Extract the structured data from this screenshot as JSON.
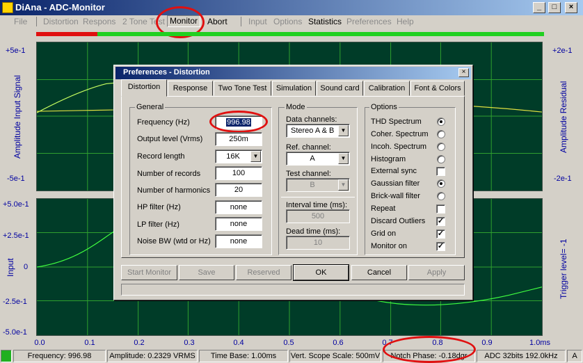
{
  "window": {
    "title": "DiAna - ADC-Monitor",
    "minimize": "_",
    "maximize": "□",
    "close": "×"
  },
  "menu": {
    "file": "File",
    "distortion": "Distortion",
    "respons": "Respons",
    "two_tone": "2 Tone Test",
    "monitor": "Monitor",
    "abort": "Abort",
    "input": "Input",
    "options": "Options",
    "statistics": "Statistics",
    "preferences": "Preferences",
    "help": "Help"
  },
  "level": {
    "left_fraction": 0.07,
    "colors": {
      "left": "#e01010",
      "right": "#20d020"
    }
  },
  "top_plot": {
    "y_left_top": "+5e-1",
    "y_left_bottom": "-5e-1",
    "y_right_top": "+2e-1",
    "y_right_bottom": "-2e-1",
    "left_label": "Amplitude Input Signal",
    "right_label": "Amplitude Residual"
  },
  "bottom_plot": {
    "y_ticks": [
      "+5.0e-1",
      "+2.5e-1",
      "0",
      "-2.5e-1",
      "-5.0e-1"
    ],
    "left_label": "Input",
    "right_label": "Trigger level= -1"
  },
  "x_ticks": [
    "0.0",
    "0.1",
    "0.2",
    "0.3",
    "0.4",
    "0.5",
    "0.6",
    "0.7",
    "0.8",
    "0.9",
    "1.0ms"
  ],
  "status": {
    "frequency": "Frequency: 996.98",
    "amplitude": "Amplitude: 0.2329 VRMS",
    "timebase": "Time Base: 1.00ms",
    "scope_scale": "Vert. Scope Scale: 500mV",
    "notch": "Notch Phase:  -0.18dgr",
    "adc": "ADC 32bits 192.0kHz",
    "mode": "A"
  },
  "dialog": {
    "title": "Preferences - Distortion",
    "close": "×",
    "tabs": [
      "Distortion",
      "Response",
      "Two Tone Test",
      "Simulation",
      "Sound card",
      "Calibration",
      "Font & Colors"
    ],
    "general": {
      "title": "General",
      "frequency_label": "Frequency (Hz)",
      "frequency": "996.98",
      "output_label": "Output level (Vrms)",
      "output": "250m",
      "record_length_label": "Record length",
      "record_length": "16K",
      "records_label": "Number of records",
      "records": "100",
      "harmonics_label": "Number of harmonics",
      "harmonics": "20",
      "hp_label": "HP filter (Hz)",
      "hp": "none",
      "lp_label": "LP filter (Hz)",
      "lp": "none",
      "noise_label": "Noise BW (wtd or Hz)",
      "noise": "none"
    },
    "mode": {
      "title": "Mode",
      "data_channels_label": "Data channels:",
      "data_channels": "Stereo A & B",
      "ref_label": "Ref. channel:",
      "ref": "A",
      "test_label": "Test channel:",
      "test": "B",
      "interval_label": "Interval time (ms):",
      "interval": "500",
      "dead_label": "Dead time (ms):",
      "dead": "10"
    },
    "options": {
      "title": "Options",
      "thd": "THD Spectrum",
      "coher": "Coher. Spectrum",
      "incoh": "Incoh. Spectrum",
      "histogram": "Histogram",
      "ext_sync": "External sync",
      "gauss": "Gaussian filter",
      "brick": "Brick-wall filter",
      "repeat": "Repeat",
      "discard": "Discard Outliers",
      "grid": "Grid on",
      "monitor": "Monitor on",
      "check": "✓"
    },
    "buttons": {
      "start": "Start  Monitor",
      "save": "Save",
      "reserved": "Reserved",
      "ok": "OK",
      "cancel": "Cancel",
      "apply": "Apply"
    }
  }
}
